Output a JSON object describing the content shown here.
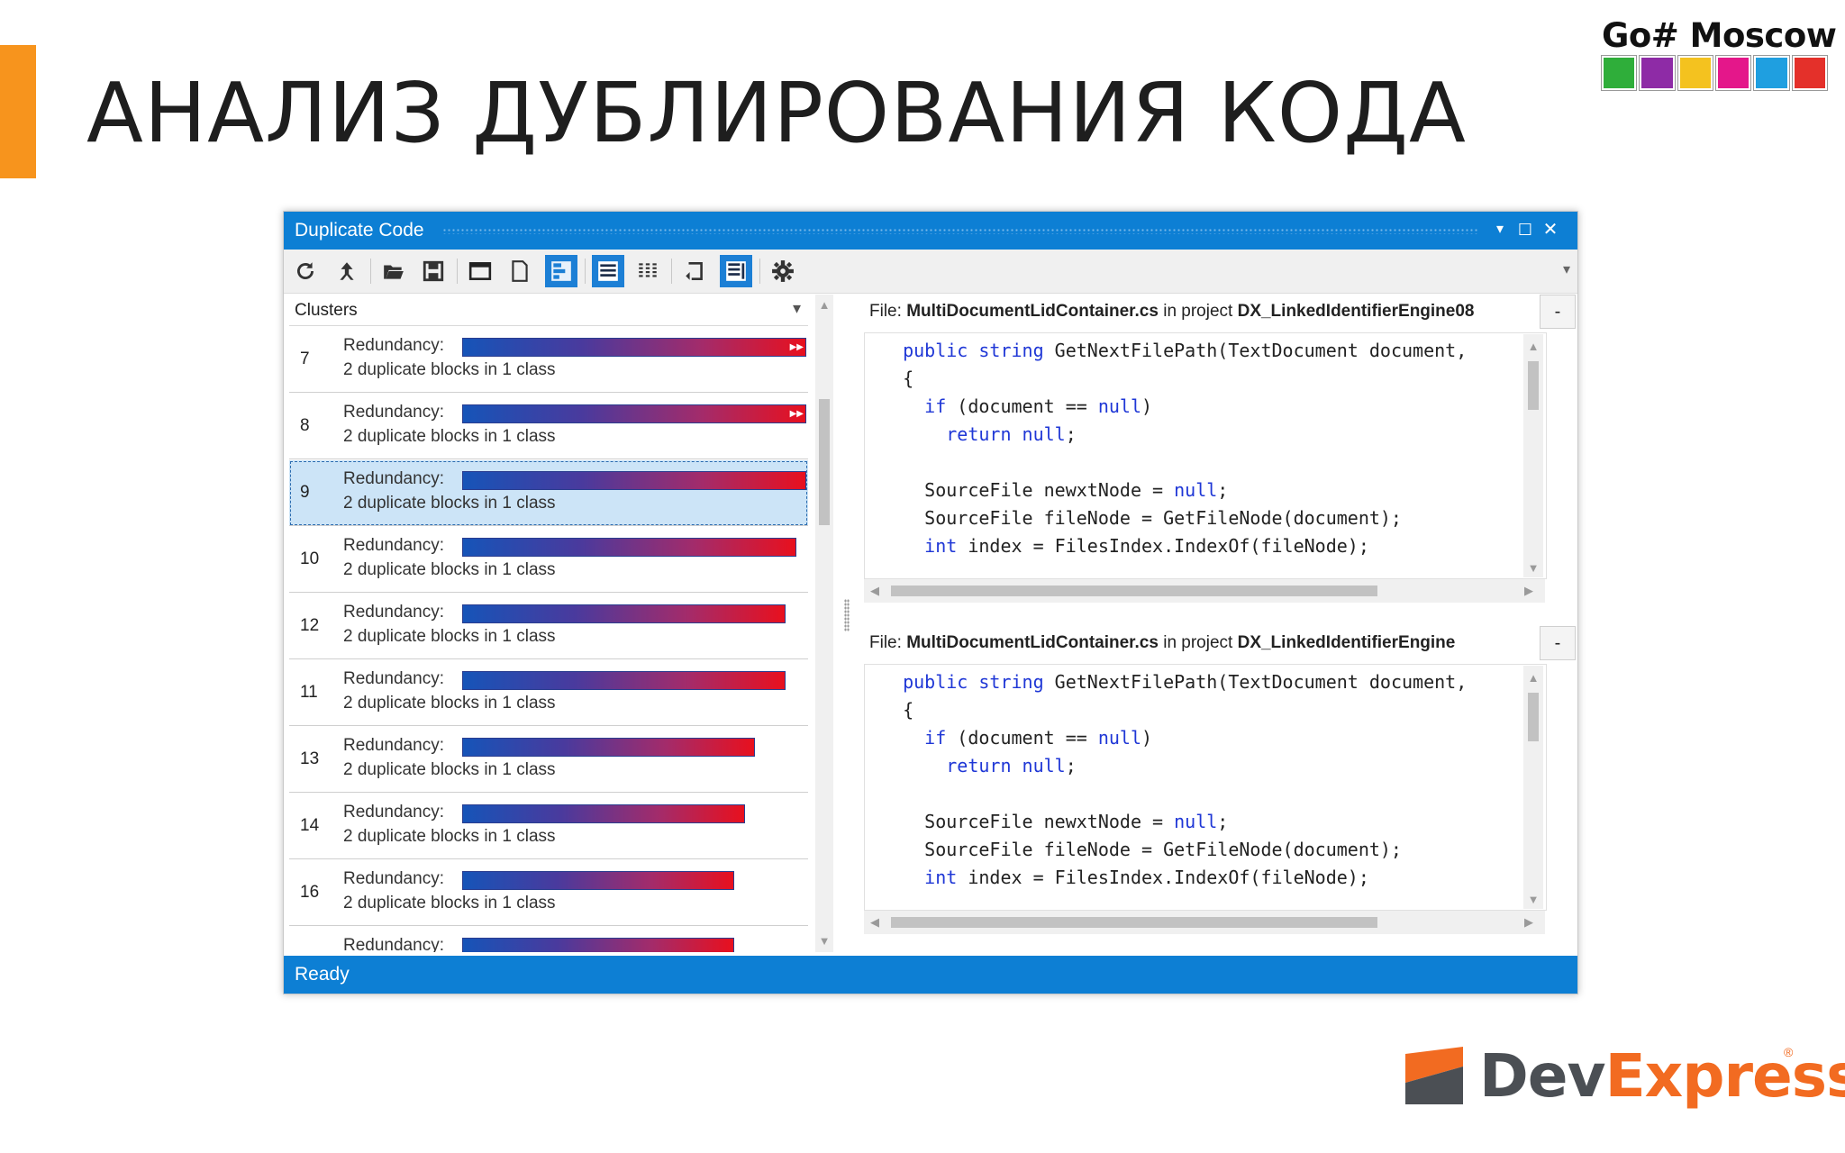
{
  "slide": {
    "title": "АНАЛИЗ ДУБЛИРОВАНИЯ КОДА",
    "accent_color": "#f7941d",
    "event_logo_text": "Go# Moscow",
    "event_logo_tile_colors": [
      "#2fae3a",
      "#8e2ba6",
      "#f4c21f",
      "#e4178a",
      "#1f9fe0",
      "#e4302a"
    ],
    "brand_logo": {
      "part1": "Dev",
      "part2": "Express",
      "reg": "®"
    }
  },
  "window": {
    "title": "Duplicate Code",
    "controls": {
      "dropdown": "▾",
      "maximize": "☐",
      "close": "✕"
    },
    "accent": "#0d7fd4",
    "toolbar": {
      "icons": [
        "refresh-icon",
        "jump-icon",
        "open-folder-icon",
        "save-icon",
        "window-icon",
        "document-icon",
        "grid-layout-icon",
        "list-view-icon",
        "columns-view-icon",
        "undo-icon",
        "panel-view-icon",
        "settings-icon"
      ],
      "overflow": "▾"
    },
    "clusters_header": {
      "label": "Clusters",
      "dropdown": "▾"
    },
    "clusters": [
      {
        "id": "7",
        "label": "Redundancy:",
        "desc": "2 duplicate blocks in 1 class",
        "redundancy": 1.0,
        "overflow": true
      },
      {
        "id": "8",
        "label": "Redundancy:",
        "desc": "2 duplicate blocks in 1 class",
        "redundancy": 1.0,
        "overflow": true
      },
      {
        "id": "9",
        "label": "Redundancy:",
        "desc": "2 duplicate blocks in 1 class",
        "redundancy": 1.0,
        "selected": true
      },
      {
        "id": "10",
        "label": "Redundancy:",
        "desc": "2 duplicate blocks in 1 class",
        "redundancy": 0.97
      },
      {
        "id": "12",
        "label": "Redundancy:",
        "desc": "2 duplicate blocks in 1 class",
        "redundancy": 0.94
      },
      {
        "id": "11",
        "label": "Redundancy:",
        "desc": "2 duplicate blocks in 1 class",
        "redundancy": 0.94
      },
      {
        "id": "13",
        "label": "Redundancy:",
        "desc": "2 duplicate blocks in 1 class",
        "redundancy": 0.85
      },
      {
        "id": "14",
        "label": "Redundancy:",
        "desc": "2 duplicate blocks in 1 class",
        "redundancy": 0.82
      },
      {
        "id": "16",
        "label": "Redundancy:",
        "desc": "2 duplicate blocks in 1 class",
        "redundancy": 0.79
      },
      {
        "id": "",
        "label": "Redundancy:",
        "desc": "",
        "redundancy": 0.79
      }
    ],
    "panes": [
      {
        "file_prefix": "File: ",
        "file_name": "MultiDocumentLidContainer.cs",
        "in_project": " in project ",
        "project": "DX_LinkedIdentifierEngine08",
        "collapse": "-"
      },
      {
        "file_prefix": "File: ",
        "file_name": "MultiDocumentLidContainer.cs",
        "in_project": " in project ",
        "project": "DX_LinkedIdentifierEngine",
        "collapse": "-"
      }
    ],
    "code_lines": [
      {
        "indent": "  ",
        "parts": [
          [
            "kw",
            "public"
          ],
          [
            "t",
            " "
          ],
          [
            "kw",
            "string"
          ],
          [
            "t",
            " GetNextFilePath(TextDocument document,"
          ]
        ]
      },
      {
        "indent": "  ",
        "parts": [
          [
            "t",
            "{"
          ]
        ]
      },
      {
        "indent": "    ",
        "parts": [
          [
            "kw",
            "if"
          ],
          [
            "t",
            " (document == "
          ],
          [
            "kw",
            "null"
          ],
          [
            "t",
            ")"
          ]
        ]
      },
      {
        "indent": "      ",
        "parts": [
          [
            "kw",
            "return"
          ],
          [
            "t",
            " "
          ],
          [
            "kw",
            "null"
          ],
          [
            "t",
            ";"
          ]
        ]
      },
      {
        "indent": "",
        "parts": [
          [
            "t",
            ""
          ]
        ]
      },
      {
        "indent": "    ",
        "parts": [
          [
            "t",
            "SourceFile newxtNode = "
          ],
          [
            "kw",
            "null"
          ],
          [
            "t",
            ";"
          ]
        ]
      },
      {
        "indent": "    ",
        "parts": [
          [
            "t",
            "SourceFile fileNode = GetFileNode(document);"
          ]
        ]
      },
      {
        "indent": "    ",
        "parts": [
          [
            "kw",
            "int"
          ],
          [
            "t",
            " index = FilesIndex.IndexOf(fileNode);"
          ]
        ]
      }
    ],
    "status": "Ready"
  }
}
